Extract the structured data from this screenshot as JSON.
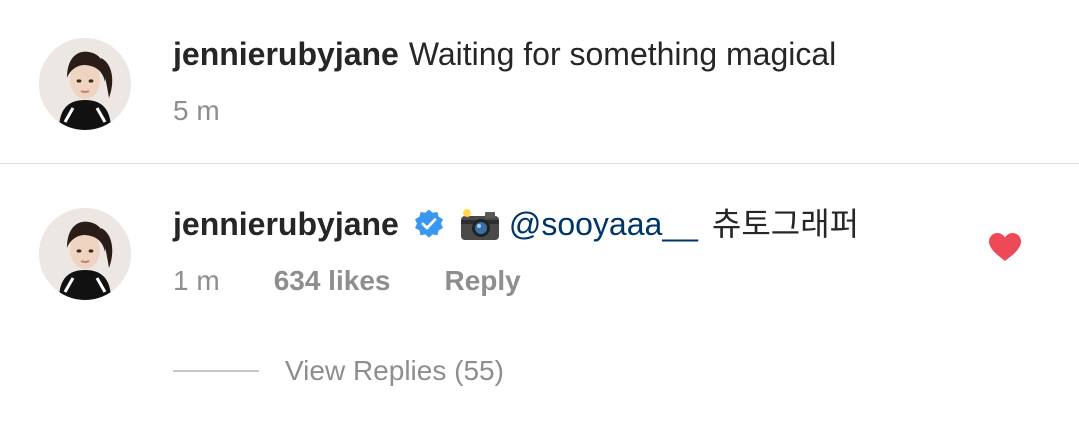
{
  "caption": {
    "username": "jennierubyjane",
    "text": "Waiting for something magical",
    "time": "5 m"
  },
  "comment": {
    "username": "jennierubyjane",
    "verified": true,
    "emoji": "camera-with-flash-icon",
    "mention": "@sooyaaa__",
    "text": "츄토그래퍼",
    "time": "1 m",
    "likes": "634 likes",
    "reply_label": "Reply",
    "liked": true,
    "heart_color": "#ed4956",
    "view_replies": "View Replies (55)"
  },
  "colors": {
    "text": "#262626",
    "secondary": "#8e8e8e",
    "mention": "#003569",
    "verified": "#3897f0",
    "divider": "#dbdbdb"
  }
}
